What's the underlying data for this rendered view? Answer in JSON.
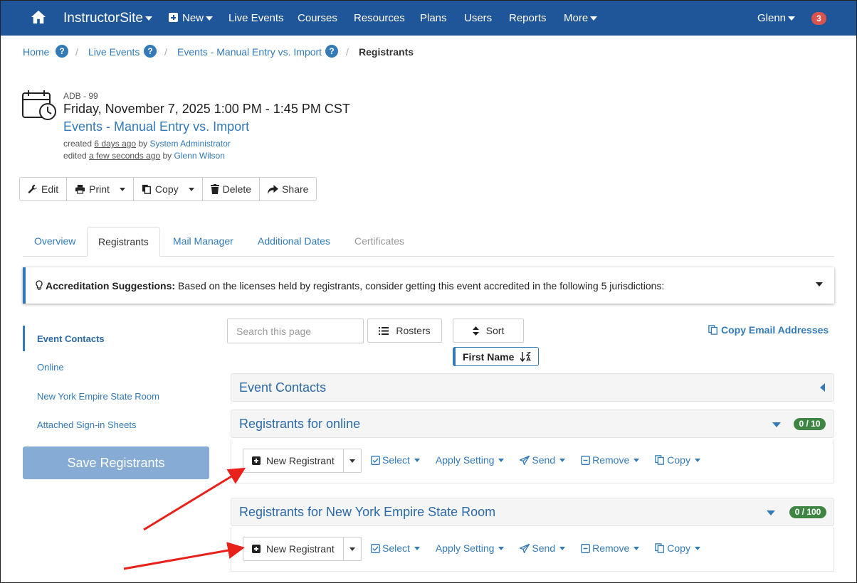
{
  "nav": {
    "brand": "InstructorSite",
    "new": "New",
    "items": [
      "Live Events",
      "Courses",
      "Resources",
      "Plans",
      "Users",
      "Reports"
    ],
    "more": "More",
    "user": "Glenn",
    "notifications": "3"
  },
  "breadcrumb": {
    "home": "Home",
    "live_events": "Live Events",
    "event": "Events - Manual Entry vs. Import",
    "current": "Registrants",
    "help": "?",
    "separator": "/"
  },
  "event": {
    "code": "ADB - 99",
    "date": "Friday, November 7, 2025 1:00 PM - 1:45 PM CST",
    "name": "Events - Manual Entry vs. Import",
    "created_prefix": "created",
    "created_when": "6 days ago",
    "by": "by",
    "created_by": "System Administrator",
    "edited_prefix": "edited",
    "edited_when": "a few seconds ago",
    "edited_by": "Glenn Wilson"
  },
  "toolbar": {
    "edit": "Edit",
    "print": "Print",
    "copy": "Copy",
    "delete": "Delete",
    "share": "Share"
  },
  "tabs": {
    "overview": "Overview",
    "registrants": "Registrants",
    "mail_manager": "Mail Manager",
    "additional_dates": "Additional Dates",
    "certificates": "Certificates"
  },
  "accreditation": {
    "title": "Accreditation Suggestions:",
    "text": "Based on the licenses held by registrants, consider getting this event accredited in the following 5 jurisdictions:"
  },
  "sidebar": {
    "items": [
      "Event Contacts",
      "Online",
      "New York Empire State Room",
      "Attached Sign-in Sheets"
    ],
    "save": "Save Registrants"
  },
  "controls": {
    "search_placeholder": "Search this page",
    "rosters": "Rosters",
    "sort": "Sort",
    "copy_emails": "Copy Email Addresses",
    "sort_field": "First Name"
  },
  "sections": {
    "contacts": {
      "title": "Event Contacts"
    },
    "online": {
      "title": "Registrants for online",
      "count": "0 / 10"
    },
    "nyesr": {
      "title": "Registrants for New York Empire State Room",
      "count": "0 / 100"
    }
  },
  "actions": {
    "new_registrant": "New Registrant",
    "select": "Select",
    "apply_setting": "Apply Setting",
    "send": "Send",
    "remove": "Remove",
    "copy": "Copy"
  },
  "colors": {
    "nav_bg": "#1f5699",
    "link": "#337ab7",
    "badge_green": "#3e8543",
    "badge_red": "#d9534f",
    "annotation_arrow": "#e8211b"
  }
}
